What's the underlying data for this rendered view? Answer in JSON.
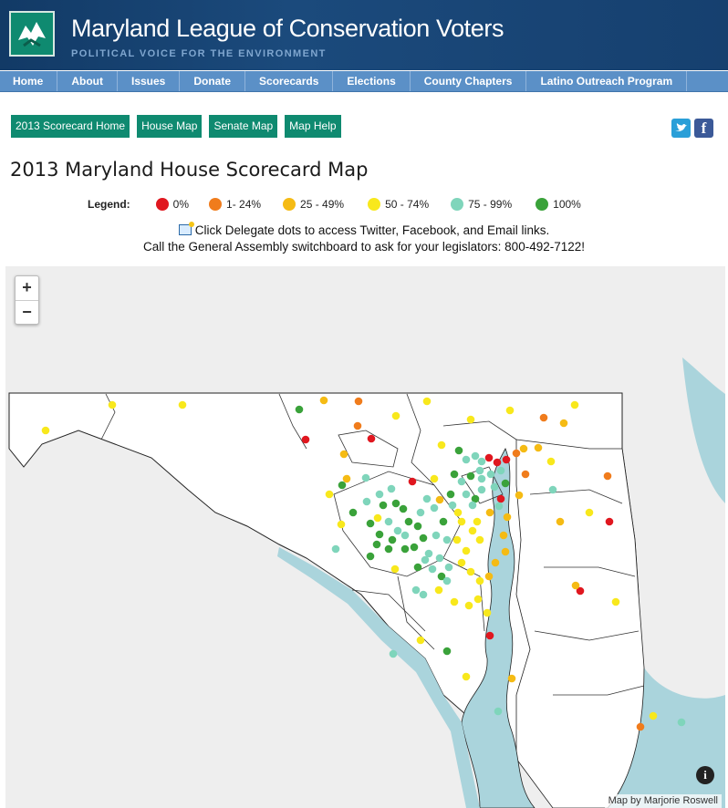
{
  "site": {
    "title": "Maryland League of Conservation Voters",
    "tagline": "POLITICAL VOICE FOR THE ENVIRONMENT",
    "logo_icon": "mlcv-logo-icon"
  },
  "nav": [
    {
      "label": "Home"
    },
    {
      "label": "About"
    },
    {
      "label": "Issues"
    },
    {
      "label": "Donate"
    },
    {
      "label": "Scorecards"
    },
    {
      "label": "Elections"
    },
    {
      "label": "County Chapters"
    },
    {
      "label": "Latino Outreach Program"
    }
  ],
  "subtabs": [
    {
      "label": "2013 Scorecard Home"
    },
    {
      "label": "House Map"
    },
    {
      "label": "Senate Map"
    },
    {
      "label": "Map Help"
    }
  ],
  "social": {
    "twitter_icon": "twitter-icon",
    "facebook_icon": "facebook-icon"
  },
  "page_title": "2013 Maryland House Scorecard Map",
  "legend": {
    "label": "Legend:",
    "items": [
      {
        "label": "0%",
        "color": "#e0171f"
      },
      {
        "label": "1- 24%",
        "color": "#f07c1c"
      },
      {
        "label": "25 - 49%",
        "color": "#f5bb14"
      },
      {
        "label": "50 - 74%",
        "color": "#f8e81c"
      },
      {
        "label": "75 - 99%",
        "color": "#7fd5bb"
      },
      {
        "label": "100%",
        "color": "#3aa23a"
      }
    ]
  },
  "info": {
    "line1": "Click Delegate dots to access Twitter, Facebook, and Email links.",
    "line2": "Call the General Assembly switchboard to ask for your legislators: 800-492-7122!"
  },
  "map": {
    "zoom_in": "+",
    "zoom_out": "−",
    "info_button": "i",
    "attribution": "Map by Marjorie Roswell",
    "water_color": "#aad4dc",
    "land_color": "#ffffff",
    "background_color": "#eeeeee"
  }
}
